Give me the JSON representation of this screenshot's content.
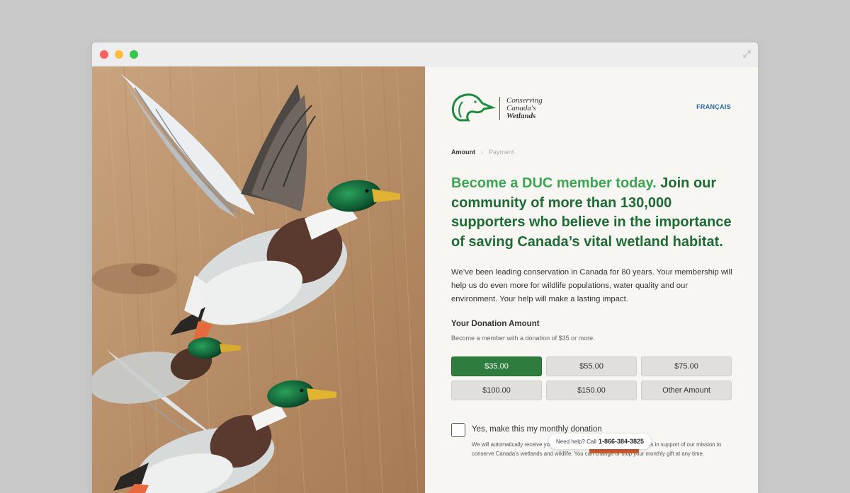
{
  "window": {
    "controls": [
      "close",
      "minimize",
      "zoom"
    ]
  },
  "logo": {
    "line1": "Conserving",
    "line2": "Canada's",
    "line3": "Wetlands"
  },
  "header": {
    "language_link": "FRANÇAIS"
  },
  "breadcrumb": {
    "step1": "Amount",
    "step2": "Payment"
  },
  "headline": {
    "highlight": "Become a DUC member today.",
    "rest": " Join our community of more than 130,000 supporters who believe in the importance of saving Canada’s vital wetland habitat."
  },
  "intro": "We’ve been leading conservation in Canada for 80 years. Your membership will help us do even more for wildlife populations, water quality and our environment. Your help will make a lasting impact.",
  "donation": {
    "title": "Your Donation Amount",
    "subtitle": "Become a member with a donation of $35 or more.",
    "amounts": [
      "$35.00",
      "$55.00",
      "$75.00",
      "$100.00",
      "$150.00",
      "Other Amount"
    ],
    "selected": "$35.00"
  },
  "monthly": {
    "label": "Yes, make this my monthly donation",
    "note": "We will automatically receive your gift each month that provides vital funds in support of our mission to conserve Canada’s wetlands and wildlife. You can change or stop your monthly gift at any time.",
    "checked": false
  },
  "help": {
    "prefix": "Need help? Call",
    "phone": "1-866-384-3825"
  },
  "colors": {
    "brand_green": "#1f6b35",
    "highlight_green": "#3aa552",
    "selected_button": "#2f7d3e",
    "link_blue": "#2a6a9e",
    "continue_orange": "#c85b2c"
  }
}
